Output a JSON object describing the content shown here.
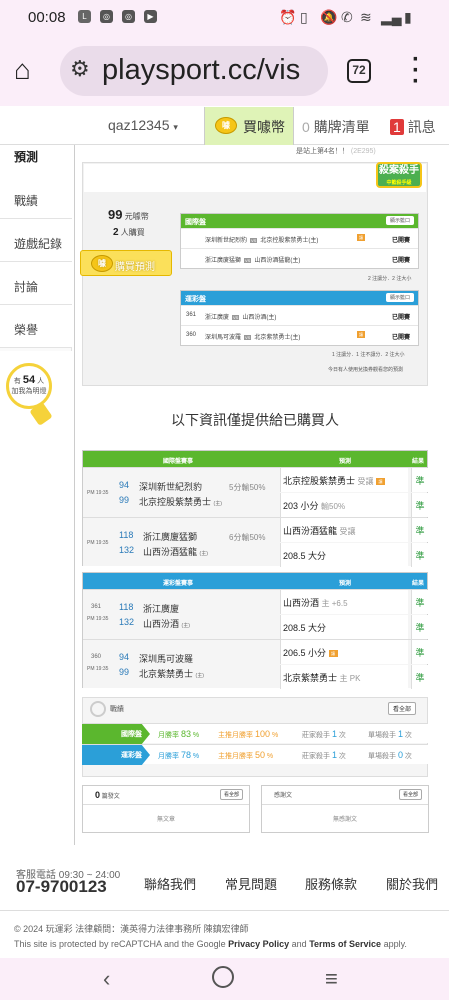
{
  "status_bar": {
    "time": "00:08"
  },
  "browser": {
    "url": "playsport.cc/vis",
    "tab_count": "72"
  },
  "header": {
    "username": "qaz12345",
    "buy_coins": "買噱幣",
    "coin_glyph": "噱",
    "cart_count": "0",
    "cart_label": "購牌清單",
    "msg_count": "1",
    "msg_label": "訊息"
  },
  "sidebar": {
    "items": [
      "預測",
      "戰績",
      "遊戲紀錄",
      "討論",
      "榮譽"
    ],
    "bulb_prefix": "有",
    "bulb_count": "54",
    "bulb_unit": "人",
    "bulb_text": "加我為明燈"
  },
  "prediction": {
    "rank_text": "是站上第4名！！",
    "rank_suffix": "(2E295)",
    "badge_title": "殺案殺手",
    "badge_sub": "中籃殺手級",
    "price": "99",
    "price_unit": "元噱幣",
    "buyers": "2",
    "buyers_unit": "人購買",
    "buy_button": "購買預測",
    "intl": {
      "title": "國際盤",
      "button": "顯示籃口",
      "rows": [
        {
          "a": "深圳新世紀烈豹",
          "vs": "VS",
          "b": "北京控股紫禁勇士(主)",
          "status": "已開賽",
          "l": "讓"
        },
        {
          "a": "浙江廣廈猛獅",
          "vs": "VS",
          "b": "山西汾酒猛龍(主)",
          "status": "已開賽"
        }
      ],
      "footer": "2 注讓分．2 注大小"
    },
    "local": {
      "title": "運彩盤",
      "button": "顯示籃口",
      "rows": [
        {
          "n": "361",
          "a": "浙江廣廈",
          "vs": "VS",
          "b": "山西汾酒(主)",
          "status": "已開賽"
        },
        {
          "n": "360",
          "a": "深圳馬可波羅",
          "vs": "VS",
          "b": "北京紫禁勇士(主)",
          "status": "已開賽",
          "l": "讓"
        }
      ],
      "footer": "1 注讓分．1 注不讓分．2 注大小",
      "note": "今日有人使用兌換券觀看您的預測"
    }
  },
  "info_text": "以下資訊僅提供給已購買人",
  "intl_table": {
    "headers": [
      "國際盤賽事",
      "預測",
      "結果"
    ],
    "matches": [
      {
        "time": "PM 19:35",
        "n1": "94",
        "t1": "深圳新世紀烈豹",
        "n2": "99",
        "t2": "北京控股紫禁勇士",
        "home": "(主)",
        "odds": "5分輸50%",
        "p1": "北京控股紫禁勇士",
        "p1s": "受讓",
        "p1b": "讓",
        "r1": "準",
        "p2": "203 小分",
        "p2s": "輸50%",
        "r2": "準"
      },
      {
        "time": "PM 19:35",
        "n1": "118",
        "t1": "浙江廣廈猛獅",
        "n2": "132",
        "t2": "山西汾酒猛龍",
        "home": "(主)",
        "odds": "6分輸50%",
        "p1": "山西汾酒猛龍",
        "p1s": "受讓",
        "r1": "準",
        "p2": "208.5 大分",
        "p2s": "",
        "r2": "準"
      }
    ]
  },
  "local_table": {
    "headers": [
      "運彩盤賽事",
      "預測",
      "結果"
    ],
    "matches": [
      {
        "code": "361",
        "time": "PM 19:35",
        "n1": "118",
        "t1": "浙江廣廈",
        "n2": "132",
        "t2": "山西汾酒",
        "home": "(主)",
        "p1": "山西汾酒",
        "p1s": "主 +6.5",
        "r1": "準",
        "p2": "208.5 大分",
        "p2s": "",
        "r2": "準"
      },
      {
        "code": "360",
        "time": "PM 19:35",
        "n1": "94",
        "t1": "深圳馬可波羅",
        "n2": "99",
        "t2": "北京紫禁勇士",
        "home": "(主)",
        "p1": "206.5 小分",
        "p1b": "讓",
        "p1s": "",
        "r1": "準",
        "p2": "北京紫禁勇士",
        "p2s": "主 PK",
        "r2": "準"
      }
    ]
  },
  "record": {
    "title": "戰績",
    "all": "看全部",
    "rows": [
      {
        "tag": "國際盤",
        "rate_l": "月勝率",
        "rate": "83",
        "pct": "%",
        "main_l": "主推月勝率",
        "main": "100",
        "killer_l": "莊家殺手",
        "killer": "1",
        "single_l": "單場殺手",
        "single": "1",
        "unit": "次"
      },
      {
        "tag": "運彩盤",
        "rate_l": "月勝率",
        "rate": "78",
        "pct": "%",
        "main_l": "主推月勝率",
        "main": "50",
        "killer_l": "莊家殺手",
        "killer": "1",
        "single_l": "單場殺手",
        "single": "0",
        "unit": "次"
      }
    ]
  },
  "articles": {
    "posts_count": "0",
    "posts_label": "篇發文",
    "posts_empty": "無文章",
    "all": "看全部",
    "replies_label": "感謝文",
    "replies_empty": "無感謝文"
  },
  "footer": {
    "phone_label": "客服電話 09:30 ~ 24:00",
    "phone": "07-9700123",
    "links": [
      "聯絡我們",
      "常見問題",
      "服務條款",
      "關於我們"
    ],
    "copyright": "© 2024 玩運彩 法律顧問：漢英得力法律事務所 陳鎮宏律師",
    "recaptcha_a": "This site is protected by reCAPTCHA and the Google ",
    "privacy": "Privacy Policy",
    "and": " and ",
    "terms": "Terms of Service",
    "apply": " apply."
  },
  "colors": {
    "green": "#5bb72e",
    "blue": "#2b9fd8",
    "accept": "#2c9a3c"
  }
}
